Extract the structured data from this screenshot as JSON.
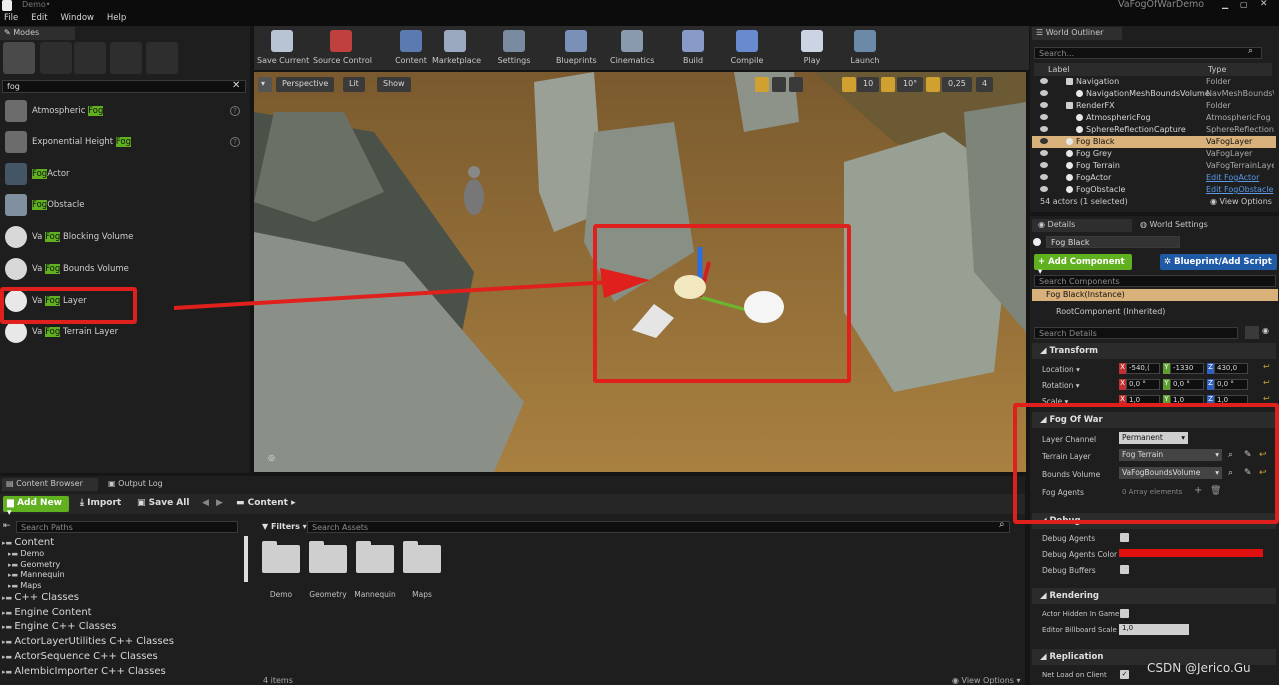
{
  "window": {
    "title": "Demo•",
    "project": "VaFogOfWarDemo"
  },
  "menu": [
    "File",
    "Edit",
    "Window",
    "Help"
  ],
  "modes": {
    "tab": "Modes",
    "search_value": "fog",
    "clear_glyph": "✕"
  },
  "place_items": [
    {
      "pre": "Atmospheric ",
      "hl": "Fog",
      "post": "",
      "help": true
    },
    {
      "pre": "Exponential Height ",
      "hl": "Fog",
      "post": "",
      "help": true
    },
    {
      "pre": "",
      "hl": "Fog",
      "post": "Actor",
      "help": false
    },
    {
      "pre": "",
      "hl": "Fog",
      "post": "Obstacle",
      "help": false
    },
    {
      "pre": "Va ",
      "hl": "Fog",
      "post": " Blocking Volume",
      "help": false
    },
    {
      "pre": "Va ",
      "hl": "Fog",
      "post": " Bounds Volume",
      "help": false
    },
    {
      "pre": "Va ",
      "hl": "Fog",
      "post": " Layer",
      "help": false
    },
    {
      "pre": "Va ",
      "hl": "Fog",
      "post": " Terrain Layer",
      "help": false
    }
  ],
  "toolbar": [
    "Save Current",
    "Source Control",
    "Content",
    "Marketplace",
    "Settings",
    "Blueprints",
    "Cinematics",
    "Build",
    "Compile",
    "Play",
    "Launch"
  ],
  "viewport": {
    "perspective": "Perspective",
    "lit": "Lit",
    "show": "Show",
    "grid_value": "10",
    "angle_value": "10°",
    "scale_value": "0,25",
    "camera_speed": "4"
  },
  "outliner": {
    "tab": "World Outliner",
    "search_placeholder": "Search...",
    "col_label": "Label",
    "col_type": "Type",
    "rows": [
      {
        "label": "Navigation",
        "type": "Folder",
        "indent": 1,
        "selected": false,
        "link": false
      },
      {
        "label": "NavigationMeshBoundsVolume",
        "type": "NavMeshBounds\\",
        "indent": 2,
        "selected": false,
        "link": false
      },
      {
        "label": "RenderFX",
        "type": "Folder",
        "indent": 1,
        "selected": false,
        "link": false
      },
      {
        "label": "AtmosphericFog",
        "type": "AtmosphericFog",
        "indent": 2,
        "selected": false,
        "link": false
      },
      {
        "label": "SphereReflectionCapture",
        "type": "SphereReflection(",
        "indent": 2,
        "selected": false,
        "link": false
      },
      {
        "label": "Fog Black",
        "type": "VaFogLayer",
        "indent": 1,
        "selected": true,
        "link": false
      },
      {
        "label": "Fog Grey",
        "type": "VaFogLayer",
        "indent": 1,
        "selected": false,
        "link": false
      },
      {
        "label": "Fog Terrain",
        "type": "VaFogTerrainLaye",
        "indent": 1,
        "selected": false,
        "link": false
      },
      {
        "label": "FogActor",
        "type": "Edit FogActor",
        "indent": 1,
        "selected": false,
        "link": true
      },
      {
        "label": "FogObstacle",
        "type": "Edit FogObstacle",
        "indent": 1,
        "selected": false,
        "link": true
      }
    ],
    "status": "54 actors (1 selected)",
    "view_options": "View Options"
  },
  "details": {
    "tab": "Details",
    "tab2": "World Settings",
    "name": "Fog Black",
    "add_component": "+ Add Component ▾",
    "blueprint": "Blueprint/Add Script",
    "search_components": "Search Components",
    "instance": "Fog Black(Instance)",
    "root": "RootComponent (Inherited)",
    "search_details": "Search Details",
    "transform": {
      "title": "Transform",
      "location": {
        "label": "Location ▾",
        "x": "-540,(",
        "y": "-1330",
        "z": "430,0"
      },
      "rotation": {
        "label": "Rotation ▾",
        "x": "0,0 °",
        "y": "0,0 °",
        "z": "0,0 °"
      },
      "scale": {
        "label": "Scale ▾",
        "x": "1,0",
        "y": "1,0",
        "z": "1,0"
      }
    },
    "fog_of_war": {
      "title": "Fog Of War",
      "layer_channel": {
        "label": "Layer Channel",
        "value": "Permanent"
      },
      "terrain_layer": {
        "label": "Terrain Layer",
        "value": "Fog Terrain"
      },
      "bounds_volume": {
        "label": "Bounds Volume",
        "value": "VaFogBoundsVolume"
      },
      "fog_agents": {
        "label": "Fog Agents",
        "value": "0 Array elements"
      }
    },
    "debug": {
      "title": "Debug",
      "agents": "Debug Agents",
      "agents_color": "Debug Agents Color",
      "buffers": "Debug Buffers",
      "agents_color_hex": "#e01010"
    },
    "rendering": {
      "title": "Rendering",
      "hidden": "Actor Hidden In Game",
      "billboard": "Editor Billboard Scale",
      "billboard_value": "1,0"
    },
    "replication": {
      "title": "Replication",
      "net_load": "Net Load on Client"
    }
  },
  "content_browser": {
    "tab": "Content Browser",
    "tab2": "Output Log",
    "add_new": "Add New ▾",
    "import": "Import",
    "save_all": "Save All",
    "path": "Content",
    "search_paths": "Search Paths",
    "filters": "Filters ▾",
    "search_assets": "Search Assets",
    "tree": [
      {
        "label": "Content",
        "level": 0
      },
      {
        "label": "Demo",
        "level": 1
      },
      {
        "label": "Geometry",
        "level": 1
      },
      {
        "label": "Mannequin",
        "level": 1
      },
      {
        "label": "Maps",
        "level": 1
      },
      {
        "label": "C++ Classes",
        "level": 0
      },
      {
        "label": "Engine Content",
        "level": 0
      },
      {
        "label": "Engine C++ Classes",
        "level": 0
      },
      {
        "label": "ActorLayerUtilities C++ Classes",
        "level": 0
      },
      {
        "label": "ActorSequence C++ Classes",
        "level": 0
      },
      {
        "label": "AlembicImporter C++ Classes",
        "level": 0
      }
    ],
    "folders": [
      "Demo",
      "Geometry",
      "Mannequin",
      "Maps"
    ],
    "item_count": "4 items",
    "view_options": "View Options"
  },
  "watermark": "CSDN @Jerico.Gu",
  "colors": {
    "accent_green": "#60b020",
    "annotation_red": "#e0201c",
    "selection": "#d8b27a",
    "blueprint_blue": "#1f5aa6"
  }
}
